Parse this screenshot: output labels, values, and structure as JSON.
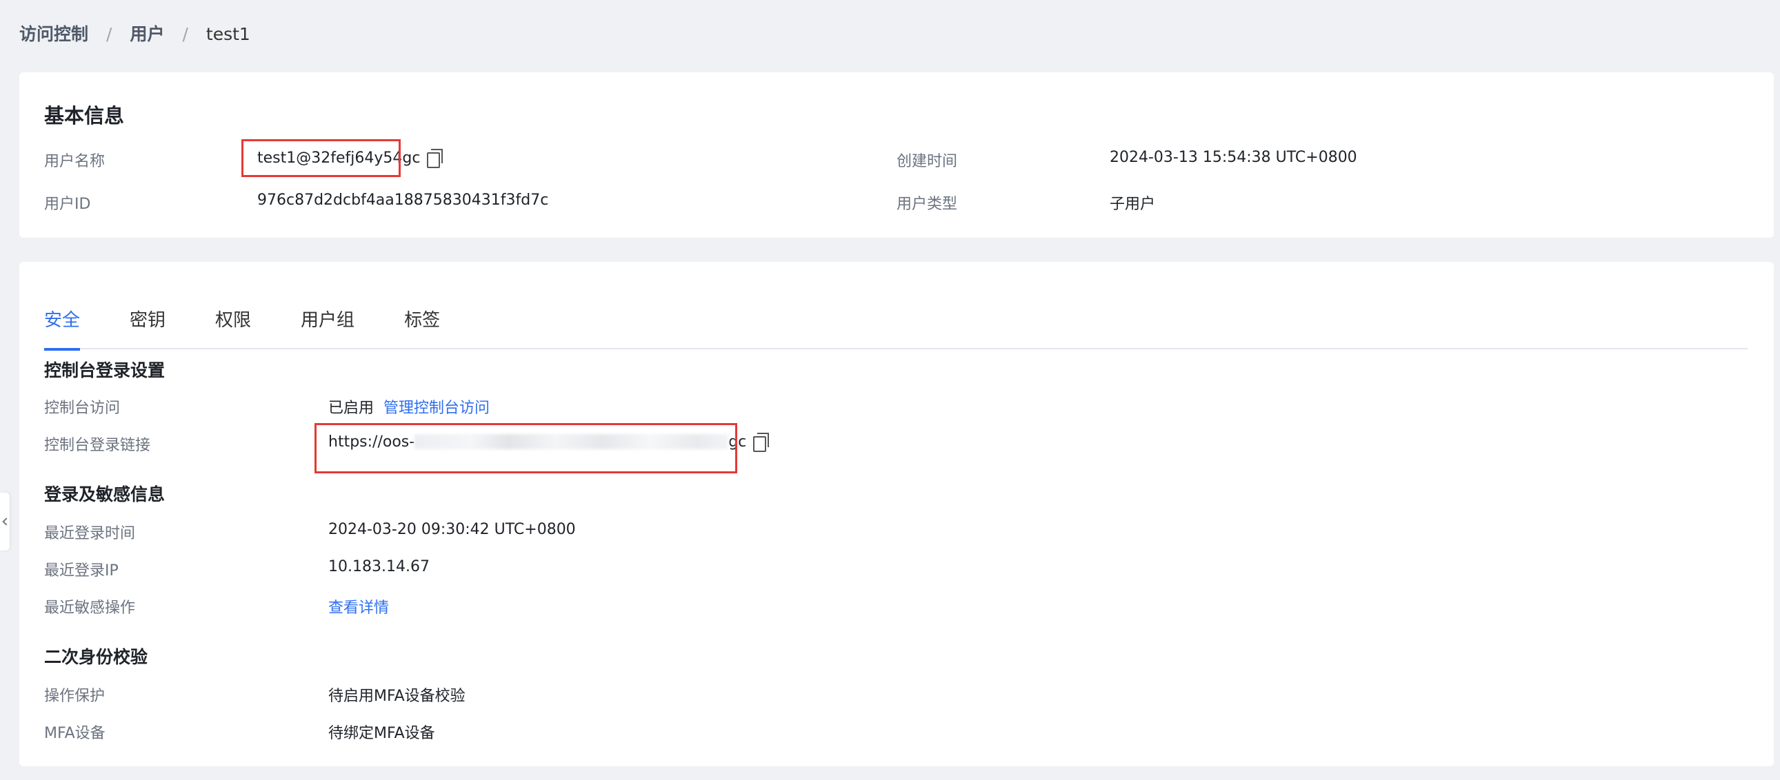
{
  "breadcrumb": {
    "items": [
      "访问控制",
      "用户"
    ],
    "current": "test1",
    "separator": "/"
  },
  "basic_info": {
    "title": "基本信息",
    "username_label": "用户名称",
    "username_value": "test1@32fefj64y54gc",
    "user_id_label": "用户ID",
    "user_id_value": "976c87d2dcbf4aa18875830431f3fd7c",
    "created_label": "创建时间",
    "created_value": "2024-03-13 15:54:38 UTC+0800",
    "user_type_label": "用户类型",
    "user_type_value": "子用户"
  },
  "tabs": [
    {
      "label": "安全",
      "active": true
    },
    {
      "label": "密钥",
      "active": false
    },
    {
      "label": "权限",
      "active": false
    },
    {
      "label": "用户组",
      "active": false
    },
    {
      "label": "标签",
      "active": false
    }
  ],
  "console_login": {
    "title": "控制台登录设置",
    "access_label": "控制台访问",
    "access_status": "已启用",
    "access_link": "管理控制台访问",
    "link_label": "控制台登录链接",
    "link_prefix": "https://oos-",
    "link_suffix": "gc"
  },
  "login_info": {
    "title": "登录及敏感信息",
    "last_login_time_label": "最近登录时间",
    "last_login_time_value": "2024-03-20 09:30:42 UTC+0800",
    "last_login_ip_label": "最近登录IP",
    "last_login_ip_value": "10.183.14.67",
    "sensitive_label": "最近敏感操作",
    "sensitive_link": "查看详情"
  },
  "mfa": {
    "title": "二次身份校验",
    "protection_label": "操作保护",
    "protection_value": "待启用MFA设备校验",
    "device_label": "MFA设备",
    "device_value": "待绑定MFA设备"
  },
  "colors": {
    "accent": "#2f6ff0",
    "highlight_box": "#e53935",
    "background": "#f0f1f4"
  }
}
